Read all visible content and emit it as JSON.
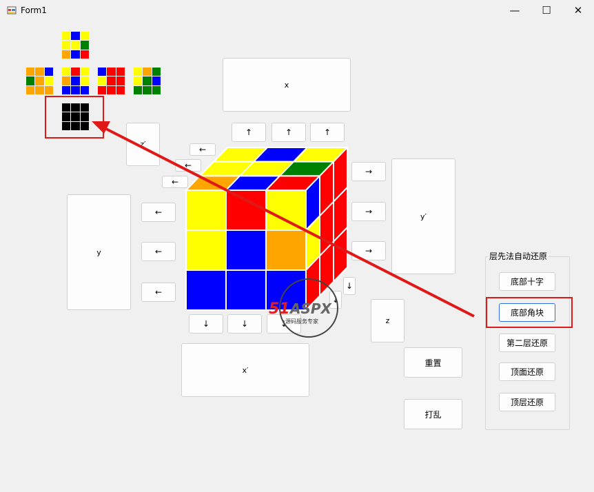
{
  "window": {
    "title": "Form1",
    "minimize": "—",
    "maximize": "☐",
    "close": "✕"
  },
  "net_faces": [
    [
      "#ffff00",
      "#0000ff",
      "#ffff00",
      "#ffff00",
      "#ffff00",
      "#008000",
      "#ffa500",
      "#0000ff",
      "#ff0000"
    ],
    [
      "#ffa500",
      "#ffa500",
      "#0000ff",
      "#008000",
      "#ffa500",
      "#ffff00",
      "#ffa500",
      "#ffa500",
      "#ffa500"
    ],
    [
      "#ffff00",
      "#ff0000",
      "#ffff00",
      "#ffa500",
      "#0000ff",
      "#ffff00",
      "#0000ff",
      "#0000ff",
      "#0000ff"
    ],
    [
      "#0000ff",
      "#ff0000",
      "#ff0000",
      "#ffff00",
      "#ff0000",
      "#ff0000",
      "#ff0000",
      "#ff0000",
      "#ff0000"
    ],
    [
      "#ffff00",
      "#ffa500",
      "#008000",
      "#ffff00",
      "#008000",
      "#0000ff",
      "#008000",
      "#008000",
      "#008000"
    ],
    [
      "#000000",
      "#000000",
      "#000000",
      "#000000",
      "#000000",
      "#000000",
      "#000000",
      "#000000",
      "#000000"
    ]
  ],
  "buttons": {
    "x": "x",
    "x_prime": "x′",
    "y": "y",
    "y_prime": "y′",
    "z": "z",
    "z_prime": "z′",
    "reset": "重置",
    "scramble": "打乱",
    "up": "↑",
    "down": "↓",
    "left": "←",
    "right": "→"
  },
  "auto_solve": {
    "label": "层先法自动还原",
    "items": [
      "底部十字",
      "底部角块",
      "第二层还原",
      "顶面还原",
      "顶层还原"
    ]
  },
  "cube": {
    "front": [
      "#ffff00",
      "#ff0000",
      "#ffff00",
      "#ffff00",
      "#0000ff",
      "#ffa500",
      "#0000ff",
      "#0000ff",
      "#0000ff"
    ],
    "top": [
      "#ffff00",
      "#0000ff",
      "#ffff00",
      "#ffff00",
      "#ffff00",
      "#008000",
      "#ffa500",
      "#0000ff",
      "#ff0000"
    ],
    "right": [
      "#0000ff",
      "#ff0000",
      "#ff0000",
      "#ffff00",
      "#ff0000",
      "#ff0000",
      "#ff0000",
      "#ff0000",
      "#ff0000"
    ]
  },
  "watermark": {
    "brand": "51ASPX",
    "tagline": "源码服务专家"
  }
}
